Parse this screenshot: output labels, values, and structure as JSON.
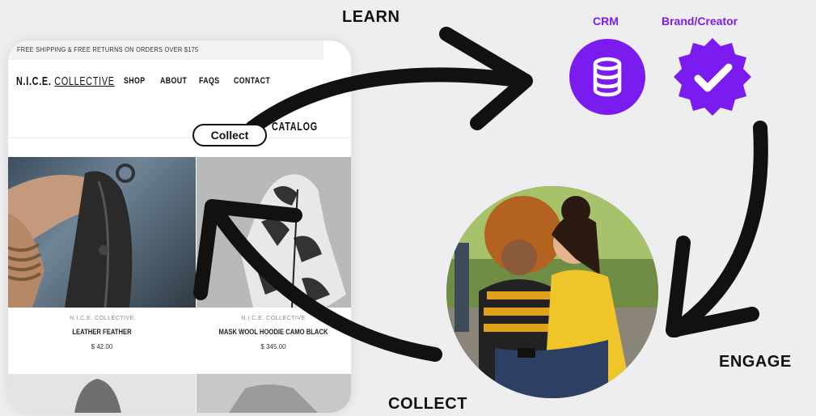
{
  "labels": {
    "learn": "LEARN",
    "engage": "ENGAGE",
    "collect": "COLLECT",
    "crm": "CRM",
    "brand_creator": "Brand/Creator"
  },
  "colors": {
    "accent": "#7a1cf0",
    "arrow": "#111111",
    "background": "#eeeef0"
  },
  "icons": {
    "crm": "database-icon",
    "brand": "verified-badge-icon"
  },
  "shop": {
    "promo": "FREE SHIPPING & FREE RETURNS ON ORDERS OVER $175",
    "brand_main": "N.I.C.E.",
    "brand_sub": "COLLECTIVE",
    "nav": [
      "SHOP",
      "ABOUT",
      "FAQS",
      "CONTACT"
    ],
    "catalog": "CATALOG",
    "collect_button": "Collect",
    "products": [
      {
        "brand": "N.I.C.E. COLLECTIVE",
        "name": "LEATHER FEATHER",
        "price": "$ 42.00"
      },
      {
        "brand": "N.I.C.E. COLLECTIVE",
        "name": "MASK WOOL HOODIE CAMO BLACK",
        "price": "$ 345.00"
      }
    ]
  }
}
